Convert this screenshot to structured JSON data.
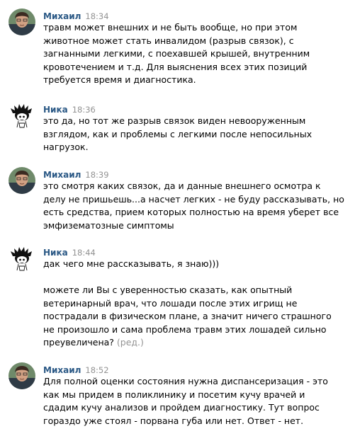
{
  "messages": [
    {
      "author": "Михаил",
      "time": "18:34",
      "avatar": "author-photo-avatar",
      "paragraphs": [
        [
          "травм может внешних и не быть вообще, но при этом",
          "животное может стать инвалидом (разрыв связок), с",
          "загнанными легкими, с поехавшей крышей, внутренним",
          "кровотечением и т.д. Для выяснения всех этих позиций",
          "требуется время и диагностика."
        ]
      ]
    },
    {
      "author": "Ника",
      "time": "18:36",
      "avatar": "cartoon-girl-avatar",
      "paragraphs": [
        [
          "это да, но тот же разрыв связок виден невооруженным",
          "взглядом, как и проблемы с легкими после непосильных",
          "нагрузок."
        ]
      ]
    },
    {
      "author": "Михаил",
      "time": "18:39",
      "avatar": "author-photo-avatar",
      "paragraphs": [
        [
          "это смотря каких связок, да и данные внешнего осмотра к",
          "делу не пришьешь...а насчет легких - не буду рассказывать, но",
          "есть средства, прием которых полностью на время уберет все",
          "эмфизематозные симптомы"
        ]
      ]
    },
    {
      "author": "Ника",
      "time": "18:44",
      "avatar": "cartoon-girl-avatar",
      "paragraphs": [
        [
          "дак чего мне рассказывать, я знаю)))"
        ],
        [
          "можете ли Вы с уверенностью сказать, как опытный",
          "ветеринарный врач, что лошади после этих игрищ не",
          "пострадали в физическом плане, а значит ничего страшного",
          "не произошло и сама проблема травм этих лошадей сильно",
          "преувеличена?"
        ]
      ],
      "edited_label": "(ред.)"
    },
    {
      "author": "Михаил",
      "time": "18:52",
      "avatar": "author-photo-avatar",
      "paragraphs": [
        [
          "Для полной оценки состояния нужна диспансеризация - это",
          "как мы придем в поликлинику и посетим кучу врачей и",
          "сдадим кучу анализов и пройдем диагностику. Тут вопрос",
          "гораздо уже стоял - порвана губа или нет. Ответ - нет."
        ]
      ]
    }
  ],
  "colors": {
    "author": "#2a5885",
    "time": "#939393",
    "text": "#000000",
    "background": "#ffffff"
  }
}
